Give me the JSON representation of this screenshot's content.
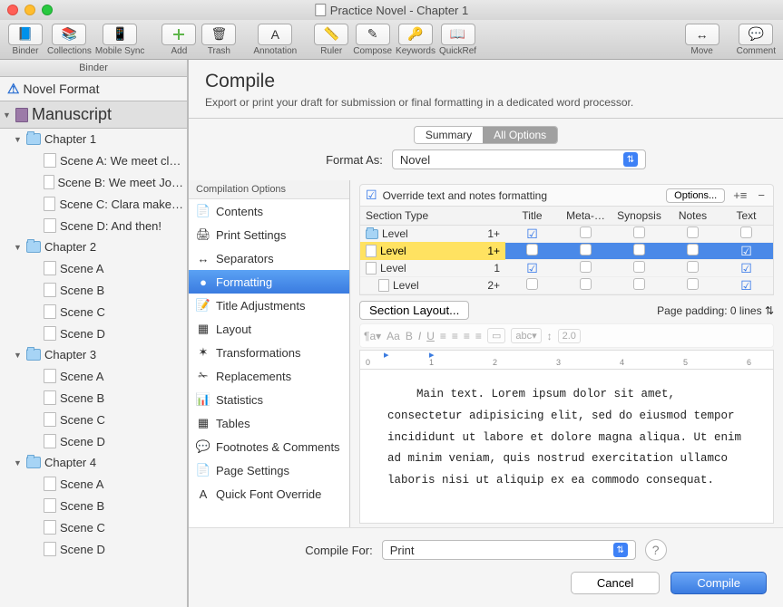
{
  "window_title": "Practice Novel - Chapter 1",
  "toolbar": [
    {
      "label": "Binder",
      "name": "binder-button"
    },
    {
      "label": "Collections",
      "name": "collections-button"
    },
    {
      "label": "Mobile Sync",
      "name": "mobile-sync-button"
    },
    {
      "label": "Add",
      "name": "add-button"
    },
    {
      "label": "Trash",
      "name": "trash-button"
    },
    {
      "label": "Annotation",
      "name": "annotation-button"
    },
    {
      "label": "Ruler",
      "name": "ruler-button"
    },
    {
      "label": "Compose",
      "name": "compose-button"
    },
    {
      "label": "Keywords",
      "name": "keywords-button"
    },
    {
      "label": "QuickRef",
      "name": "quickref-button"
    },
    {
      "label": "Move",
      "name": "move-button"
    },
    {
      "label": "Comment",
      "name": "comment-button"
    }
  ],
  "binder": {
    "header": "Binder",
    "root": "Novel Format",
    "manuscript": "Manuscript",
    "chapters": [
      {
        "title": "Chapter 1",
        "scenes": [
          "Scene A: We meet cl…",
          "Scene B: We meet Jo…",
          "Scene C: Clara make…",
          "Scene D: And then!"
        ]
      },
      {
        "title": "Chapter 2",
        "scenes": [
          "Scene A",
          "Scene B",
          "Scene C",
          "Scene D"
        ]
      },
      {
        "title": "Chapter 3",
        "scenes": [
          "Scene A",
          "Scene B",
          "Scene C",
          "Scene D"
        ]
      },
      {
        "title": "Chapter 4",
        "scenes": [
          "Scene A",
          "Scene B",
          "Scene C",
          "Scene D"
        ]
      }
    ]
  },
  "compile": {
    "title": "Compile",
    "subtitle": "Export or print your draft for submission or final formatting in a dedicated word processor.",
    "tabs": {
      "summary": "Summary",
      "all_options": "All Options"
    },
    "format_as_label": "Format As:",
    "format_as_value": "Novel",
    "options_header": "Compilation Options",
    "options": [
      {
        "label": "Contents",
        "icon": "📄"
      },
      {
        "label": "Print Settings",
        "icon": "🖨"
      },
      {
        "label": "Separators",
        "icon": "↔"
      },
      {
        "label": "Formatting",
        "icon": "●",
        "selected": true
      },
      {
        "label": "Title Adjustments",
        "icon": "📝"
      },
      {
        "label": "Layout",
        "icon": "▦"
      },
      {
        "label": "Transformations",
        "icon": "✶"
      },
      {
        "label": "Replacements",
        "icon": "✁"
      },
      {
        "label": "Statistics",
        "icon": "📊"
      },
      {
        "label": "Tables",
        "icon": "▦"
      },
      {
        "label": "Footnotes & Comments",
        "icon": "💬"
      },
      {
        "label": "Page Settings",
        "icon": "📄"
      },
      {
        "label": "Quick Font Override",
        "icon": "A"
      }
    ],
    "override_checkbox_label": "Override text and notes formatting",
    "options_button": "Options...",
    "columns": [
      "Section Type",
      "Title",
      "Meta-…",
      "Synopsis",
      "Notes",
      "Text"
    ],
    "rows": [
      {
        "type": "Level",
        "depth": "1+",
        "icon": "folder",
        "title": true,
        "meta": false,
        "synopsis": false,
        "notes": false,
        "text": false,
        "style": "normal"
      },
      {
        "type": "Level",
        "depth": "1+",
        "icon": "doc",
        "title": false,
        "meta": false,
        "synopsis": false,
        "notes": false,
        "text": true,
        "style": "sel"
      },
      {
        "type": "Level",
        "depth": "1",
        "icon": "doc",
        "title": true,
        "meta": false,
        "synopsis": false,
        "notes": false,
        "text": true,
        "style": "normal"
      },
      {
        "type": "Level",
        "depth": "2+",
        "icon": "doc",
        "title": false,
        "meta": false,
        "synopsis": false,
        "notes": false,
        "text": true,
        "style": "normal"
      }
    ],
    "section_layout_btn": "Section Layout...",
    "page_padding": "Page padding: 0 lines",
    "line_spacing_value": "2.0",
    "font_select": "abc",
    "ruler_marks": [
      "0",
      "1",
      "2",
      "3",
      "4",
      "5",
      "6"
    ],
    "preview_text": "Main text. Lorem ipsum dolor sit amet, consectetur adipisicing elit, sed do eiusmod tempor incididunt ut labore et dolore magna aliqua. Ut enim ad minim veniam, quis nostrud exercitation ullamco laboris nisi ut aliquip ex ea commodo consequat.",
    "compile_for_label": "Compile For:",
    "compile_for_value": "Print",
    "cancel": "Cancel",
    "compile_btn": "Compile"
  }
}
